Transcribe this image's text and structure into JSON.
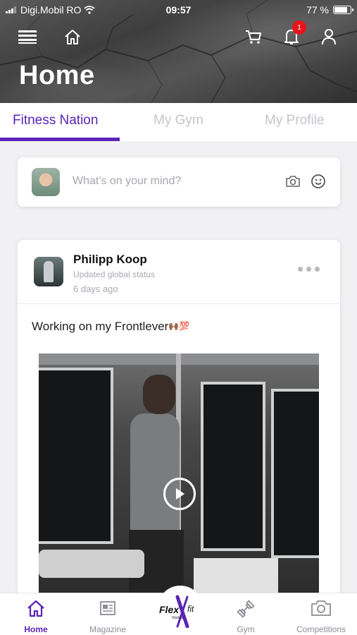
{
  "status_bar": {
    "carrier": "Digi.Mobil RO",
    "time": "09:57",
    "battery": "77 %",
    "battery_level": 0.77
  },
  "header": {
    "title": "Home",
    "notification_count": "1",
    "icons": [
      "menu-icon",
      "home-icon",
      "cart-icon",
      "bell-icon",
      "user-icon"
    ]
  },
  "tabs": [
    {
      "label": "Fitness Nation",
      "active": true
    },
    {
      "label": "My Gym",
      "active": false
    },
    {
      "label": "My Profile",
      "active": false
    }
  ],
  "composer": {
    "placeholder": "What's on your mind?"
  },
  "post": {
    "author": "Philipp Koop",
    "status": "Updated global status",
    "time_ago": "6 days ago",
    "text": "Working on my Frontlever",
    "emojis": "🙌🏾💯"
  },
  "bottom_nav": [
    {
      "label": "Home",
      "icon": "home-icon",
      "active": true
    },
    {
      "label": "Magazine",
      "icon": "newspaper-icon",
      "active": false
    },
    {
      "label": "",
      "icon": "flexfit-logo",
      "active": false
    },
    {
      "label": "Gym",
      "icon": "dumbbell-icon",
      "active": false
    },
    {
      "label": "Competitions",
      "icon": "camera-icon",
      "active": false
    }
  ],
  "logo": {
    "flex": "Flex",
    "fit": "fit",
    "sub": "Wattrup"
  },
  "colors": {
    "accent": "#5b24b8",
    "badge": "#e8141c",
    "inactive_tab": "#c4c4cc"
  }
}
